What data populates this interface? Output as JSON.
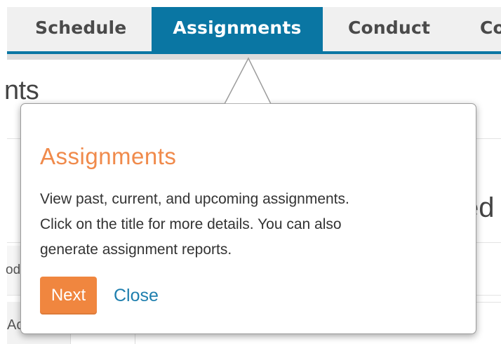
{
  "tabs": [
    {
      "label": "Schedule",
      "active": false
    },
    {
      "label": "Assignments",
      "active": true
    },
    {
      "label": "Conduct",
      "active": false
    },
    {
      "label": "Co",
      "active": false
    }
  ],
  "background": {
    "title_fragment": "nts",
    "right_fragment": "ed",
    "side_fragment": "od",
    "cell_fragment": "Ac"
  },
  "popover": {
    "title": "Assignments",
    "body_lines": [
      "View past, current, and upcoming assignments.",
      "Click on the title for more details. You can also",
      "generate assignment reports."
    ],
    "next_label": "Next",
    "close_label": "Close"
  },
  "colors": {
    "tab_active": "#0a76a3",
    "tab_bar": "#f0f0f0",
    "popover_title": "#f08a4b",
    "next_button": "#f0863f",
    "close_link": "#1f7fae"
  }
}
